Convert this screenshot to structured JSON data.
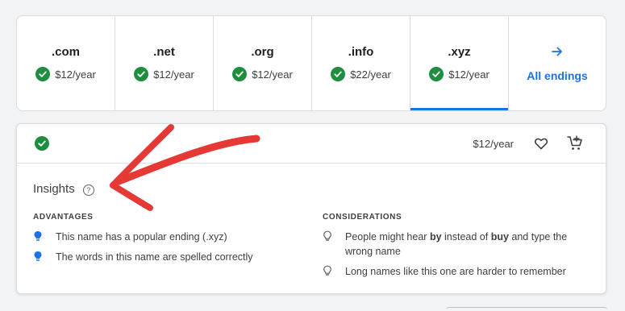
{
  "tlds": [
    {
      "name": ".com",
      "price": "$12/year",
      "active": false
    },
    {
      "name": ".net",
      "price": "$12/year",
      "active": false
    },
    {
      "name": ".org",
      "price": "$12/year",
      "active": false
    },
    {
      "name": ".info",
      "price": "$22/year",
      "active": false
    },
    {
      "name": ".xyz",
      "price": "$12/year",
      "active": true
    }
  ],
  "all_endings_label": "All endings",
  "result": {
    "price": "$12/year",
    "heart_icon": "heart-outline-icon",
    "cart_icon": "add-to-cart-icon"
  },
  "insights": {
    "title": "Insights",
    "help_glyph": "?",
    "advantages_heading": "ADVANTAGES",
    "advantages": [
      "This name has a popular ending (.xyz)",
      "The words in this name are spelled correctly"
    ],
    "considerations_heading": "CONSIDERATIONS",
    "considerations": [
      {
        "before": "People might hear ",
        "bold1": "by",
        "middle": " instead of ",
        "bold2": "buy",
        "after": " and type the wrong name"
      },
      {
        "text": "Long names like this one are harder to remember"
      }
    ]
  },
  "colors": {
    "accent": "#1a73e8",
    "check": "#1e8e3e",
    "annotation": "#e53935"
  }
}
